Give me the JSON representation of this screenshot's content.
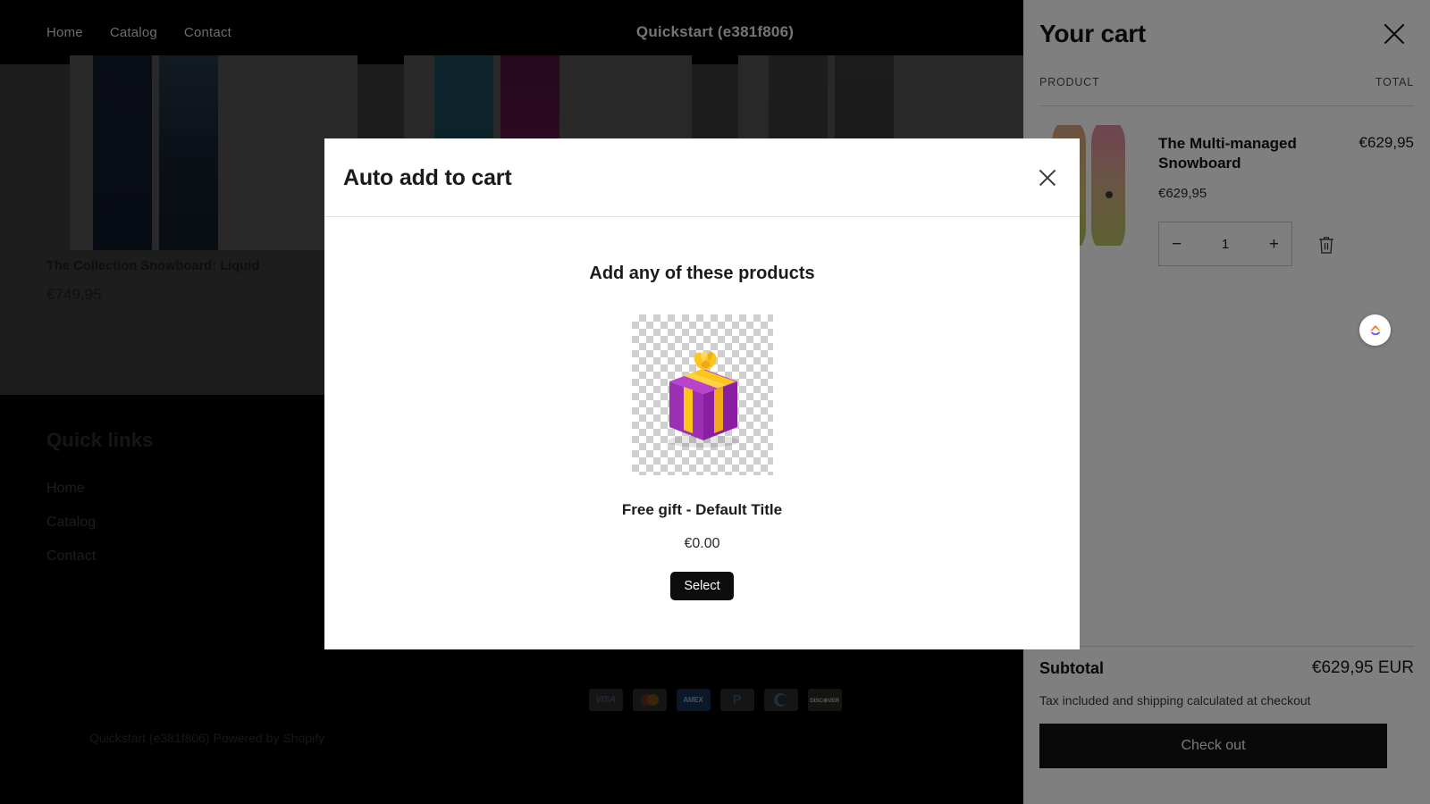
{
  "header": {
    "title": "Quickstart (e381f806)",
    "nav": [
      {
        "label": "Home"
      },
      {
        "label": "Catalog"
      },
      {
        "label": "Contact"
      }
    ]
  },
  "collection": {
    "products": [
      {
        "title": "The Collection Snowboard: Liquid",
        "price": "€749,95"
      }
    ]
  },
  "footer": {
    "quick_links_title": "Quick links",
    "quick_links": [
      {
        "label": "Home"
      },
      {
        "label": "Catalog"
      },
      {
        "label": "Contact"
      }
    ],
    "payment_methods": [
      {
        "name": "visa-icon",
        "label": "VISA"
      },
      {
        "name": "mastercard-icon",
        "label": ""
      },
      {
        "name": "amex-icon",
        "label": "AMEX"
      },
      {
        "name": "paypal-icon",
        "label": "P"
      },
      {
        "name": "diners-club-icon",
        "label": ""
      },
      {
        "name": "discover-icon",
        "label": "DISC⊕VER"
      }
    ],
    "copyright": "Quickstart (e381f806) Powered by Shopify"
  },
  "cart": {
    "title": "Your cart",
    "close_icon": "close-icon",
    "column_product": "PRODUCT",
    "column_total": "TOTAL",
    "item": {
      "title": "The Multi-managed Snowboard",
      "unit_price": "€629,95",
      "line_total": "€629,95",
      "quantity": "1",
      "decrease_label": "−",
      "increase_label": "+",
      "remove_icon": "trash-icon"
    },
    "subtotal_label": "Subtotal",
    "subtotal_value": "€629,95 EUR",
    "tax_note": "Tax included and shipping calculated at checkout",
    "checkout_label": "Check out"
  },
  "modal": {
    "title": "Auto add to cart",
    "close_icon": "close-icon",
    "subtitle": "Add any of these products",
    "product": {
      "image_alt": "gift-box-image",
      "name": "Free gift - Default Title",
      "price": "€0.00",
      "select_label": "Select"
    }
  },
  "badge": {
    "name": "loyalty-app-launcher-icon"
  },
  "colors": {
    "accent_dark": "#121212",
    "modal_bg": "#ffffff",
    "overlay": "rgba(0,0,0,0.5)",
    "gift_purple": "#a435b8",
    "gift_ribbon": "#f5c518"
  }
}
